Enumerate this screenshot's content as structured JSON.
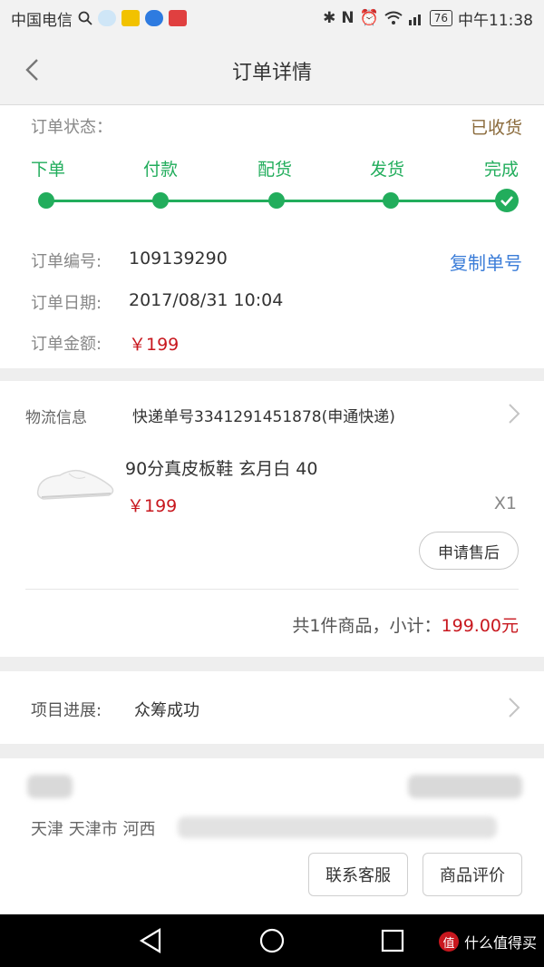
{
  "status_bar": {
    "carrier": "中国电信",
    "battery": "76",
    "time": "中午11:38",
    "icons": [
      "search-icon",
      "weather-icon",
      "app-icon",
      "baidu-icon",
      "app-icon",
      "bluetooth-icon",
      "nfc-icon",
      "alarm-icon",
      "wifi-icon",
      "signal-icon"
    ]
  },
  "header": {
    "title": "订单详情",
    "back_icon": "chevron-left-icon"
  },
  "order": {
    "status_label": "订单状态：",
    "status_value": "已收货",
    "steps": [
      "下单",
      "付款",
      "配货",
      "发货",
      "完成"
    ],
    "number_label": "订单编号:",
    "number_value": "109139290",
    "copy_label": "复制单号",
    "date_label": "订单日期:",
    "date_value": "2017/08/31 10:04",
    "amount_label": "订单金额:",
    "amount_value": "￥199",
    "accent_color": "#22ad5c"
  },
  "logistics": {
    "label": "物流信息",
    "value": "快递单号3341291451878(申通快递)",
    "product_name": "90分真皮板鞋 玄月白 40",
    "product_price": "￥199",
    "quantity": "X1",
    "after_sale_button": "申请售后",
    "subtotal_prefix": "共1件商品，小计：",
    "subtotal_value": "199.00元"
  },
  "project": {
    "label": "项目进展:",
    "value": "众筹成功"
  },
  "address": {
    "text": "天津 天津市 河西",
    "contact_button": "联系客服",
    "review_button": "商品评价"
  },
  "watermark": {
    "badge": "值",
    "text": "什么值得买"
  }
}
